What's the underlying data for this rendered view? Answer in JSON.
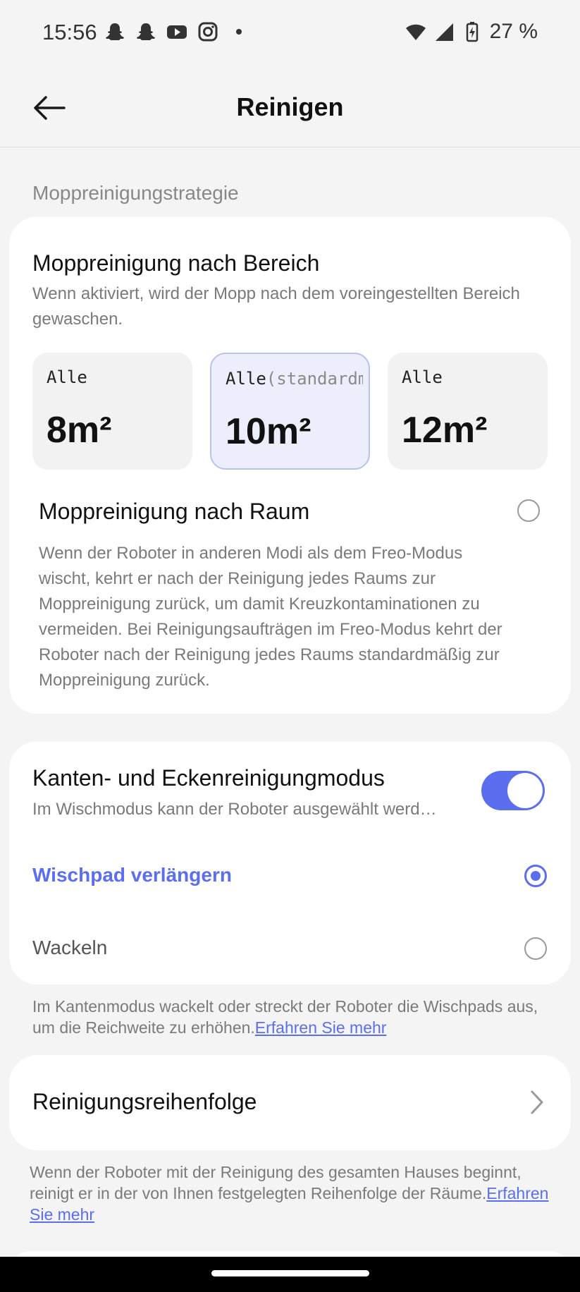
{
  "status_bar": {
    "time": "15:56",
    "battery": "27 %",
    "icons_left": [
      "snapchat-icon",
      "snapchat-icon",
      "youtube-icon",
      "instagram-icon",
      "dot-icon"
    ],
    "icons_right": [
      "wifi-icon",
      "signal-icon",
      "battery-charging-icon"
    ]
  },
  "header": {
    "title": "Reinigen",
    "back_icon": "arrow-left-icon"
  },
  "section_label": "Moppreinigungstrategie",
  "mop_by_area": {
    "title": "Moppreinigung nach Bereich",
    "description": "Wenn aktiviert, wird der Mopp nach dem voreingestellten Bereich gewaschen.",
    "tiles": [
      {
        "label": "Alle",
        "sub": "",
        "value": "8m²",
        "selected": false
      },
      {
        "label": "Alle",
        "sub": "(standardmäßig)",
        "value": "10m²",
        "selected": true
      },
      {
        "label": "Alle",
        "sub": "",
        "value": "12m²",
        "selected": false
      }
    ]
  },
  "mop_by_room": {
    "title": "Moppreinigung nach Raum",
    "checked": false,
    "description": "Wenn der Roboter in anderen Modi als dem Freo-Modus wischt, kehrt er nach der Reinigung jedes Raums zur Moppreinigung zurück, um damit Kreuzkontaminationen zu vermeiden. Bei Reinigungsaufträgen im Freo-Modus kehrt der Roboter nach der Reinigung jedes Raums standardmäßig zur Moppreinigung zurück."
  },
  "edge_mode": {
    "title": "Kanten- und Eckenreinigungmodus",
    "description": "Im Wischmodus kann der Roboter ausgewählt werd…",
    "enabled": true,
    "options": [
      {
        "label": "Wischpad verlängern",
        "checked": true
      },
      {
        "label": "Wackeln",
        "checked": false
      }
    ],
    "note": "Im Kantenmodus wackelt oder streckt der Roboter die Wischpads aus, um die Reichweite zu erhöhen.",
    "note_link": "Erfahren Sie mehr"
  },
  "cleaning_order": {
    "title": "Reinigungsreihenfolge",
    "chevron_icon": "chevron-right-icon",
    "note": "Wenn der Roboter mit der Reinigung des gesamten Hauses beginnt, reinigt er in der von Ihnen festgelegten Reihenfolge der Räume.",
    "note_link": "Erfahren Sie mehr"
  },
  "colors": {
    "accent": "#5b6ef0",
    "background": "#f4f4f5",
    "card": "#ffffff",
    "muted_text": "#7a7a7a"
  }
}
